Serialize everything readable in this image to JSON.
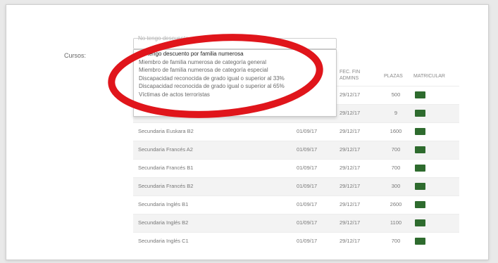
{
  "form": {
    "cursos_label": "Cursos:",
    "select_value": "No tengo descuento por familia numerosa"
  },
  "dropdown_options": [
    "No tengo descuento por familia numerosa",
    "Miembro de familia numerosa de categoría general",
    "Miembro de familia numerosa de categoría especial",
    "Discapacidad reconocida de grado igual o superior al 33%",
    "Discapacidad reconocida de grado igual o superior al 65%",
    "Víctimas de actos terroristas"
  ],
  "table": {
    "headers": {
      "fec_fin": "FEC. FIN ADMINS",
      "plazas": "PLAZAS",
      "matricular": "MATRICULAR"
    },
    "rows": [
      {
        "name": "",
        "start": "",
        "end": "29/12/17",
        "plazas": "500"
      },
      {
        "name": "",
        "start": "",
        "end": "29/12/17",
        "plazas": "9"
      },
      {
        "name": "Secundaria Euskara B2",
        "start": "01/09/17",
        "end": "29/12/17",
        "plazas": "1600"
      },
      {
        "name": "Secundaria Francés A2",
        "start": "01/09/17",
        "end": "29/12/17",
        "plazas": "700"
      },
      {
        "name": "Secundaria Francés B1",
        "start": "01/09/17",
        "end": "29/12/17",
        "plazas": "700"
      },
      {
        "name": "Secundaria Francés B2",
        "start": "01/09/17",
        "end": "29/12/17",
        "plazas": "300"
      },
      {
        "name": "Secundaria Inglés B1",
        "start": "01/09/17",
        "end": "29/12/17",
        "plazas": "2600"
      },
      {
        "name": "Secundaria Inglés B2",
        "start": "01/09/17",
        "end": "29/12/17",
        "plazas": "1100"
      },
      {
        "name": "Secundaria Inglés C1",
        "start": "01/09/17",
        "end": "29/12/17",
        "plazas": "700"
      }
    ]
  },
  "colors": {
    "matricular_button": "#2e6b2e",
    "highlight_ellipse": "#e0151b"
  }
}
